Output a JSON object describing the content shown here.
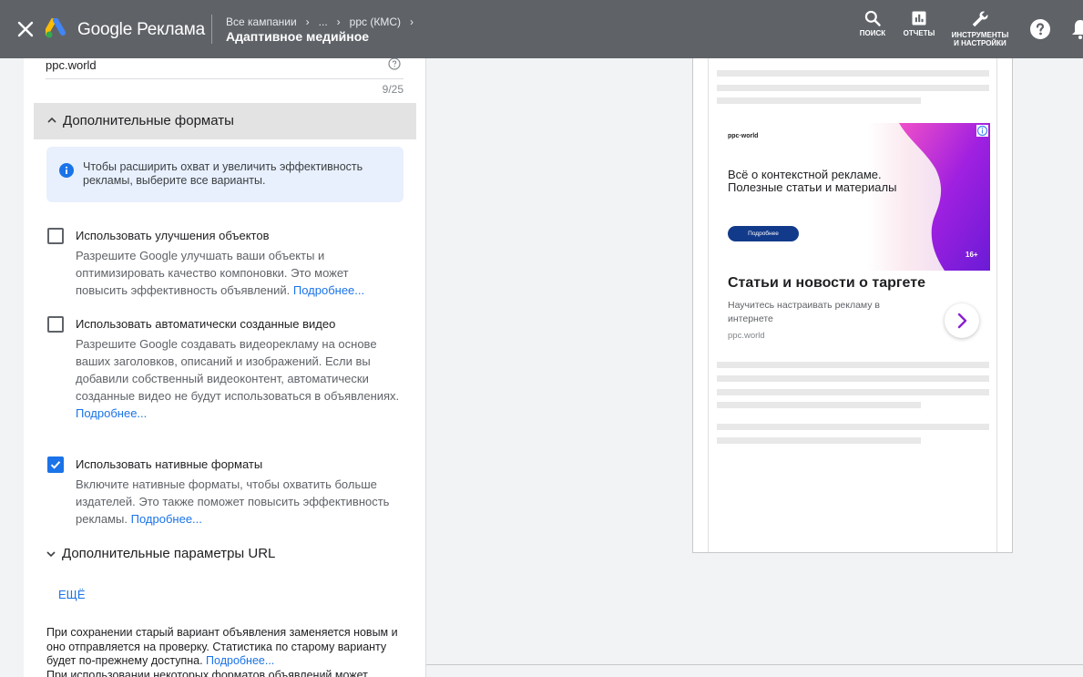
{
  "header": {
    "close_icon": "close-icon",
    "brand": "Google Реклама",
    "breadcrumbs": [
      "Все кампании",
      "...",
      "ppc (КМС)"
    ],
    "page_title": "Адаптивное медийное",
    "tools": {
      "search": "ПОИСК",
      "reports": "ОТЧЕТЫ",
      "tools_line1": "ИНСТРУМЕНТЫ",
      "tools_line2": "И НАСТРОЙКИ"
    }
  },
  "form": {
    "business_name_value": "ppc.world",
    "business_name_counter": "9/25",
    "extra_formats": {
      "title": "Дополнительные форматы",
      "info": "Чтобы расширить охват и увеличить эффективность рекламы, выберите все варианты.",
      "options": [
        {
          "label": "Использовать улучшения объектов",
          "checked": false,
          "desc": "Разрешите Google улучшать ваши объекты и оптимизировать качество компоновки. Это может повысить эффективность объявлений.",
          "link": "Подробнее..."
        },
        {
          "label": "Использовать автоматически созданные видео",
          "checked": false,
          "desc": "Разрешите Google создавать видеорекламу на основе ваших заголовков, описаний и изображений. Если вы добавили собственный видеоконтент, автоматически созданные видео не будут использоваться в объявлениях.",
          "link": "Подробнее..."
        },
        {
          "label": "Использовать нативные форматы",
          "checked": true,
          "desc": "Включите нативные форматы, чтобы охватить больше издателей. Это также поможет повысить эффективность рекламы.",
          "link": "Подробнее..."
        }
      ]
    },
    "url_options_title": "Дополнительные параметры URL",
    "more_button": "ЕЩЁ",
    "footer_note": "При сохранении старый вариант объявления заменяется новым и оно отправляется на проверку. Статистика по старому варианту будет по-прежнему доступна.",
    "footer_link": "Подробнее...",
    "footer_note2": "При использовании некоторых форматов объявлений может"
  },
  "preview": {
    "banner_brand": "ppc·world",
    "banner_headline": "Всё о контекстной рекламе. Полезные статьи и материалы",
    "banner_cta": "Подробнее",
    "banner_age": "16+",
    "ad_title": "Статьи и новости о таргете",
    "ad_desc": "Научитесь настраивать рекламу в интернете",
    "ad_domain": "ppc.world"
  },
  "colors": {
    "header_bg": "#5f6368",
    "link": "#1a73e8",
    "info_bg": "#e8f0fe",
    "cta_bg": "#123a8a",
    "arrow": "#8b1fd1"
  }
}
